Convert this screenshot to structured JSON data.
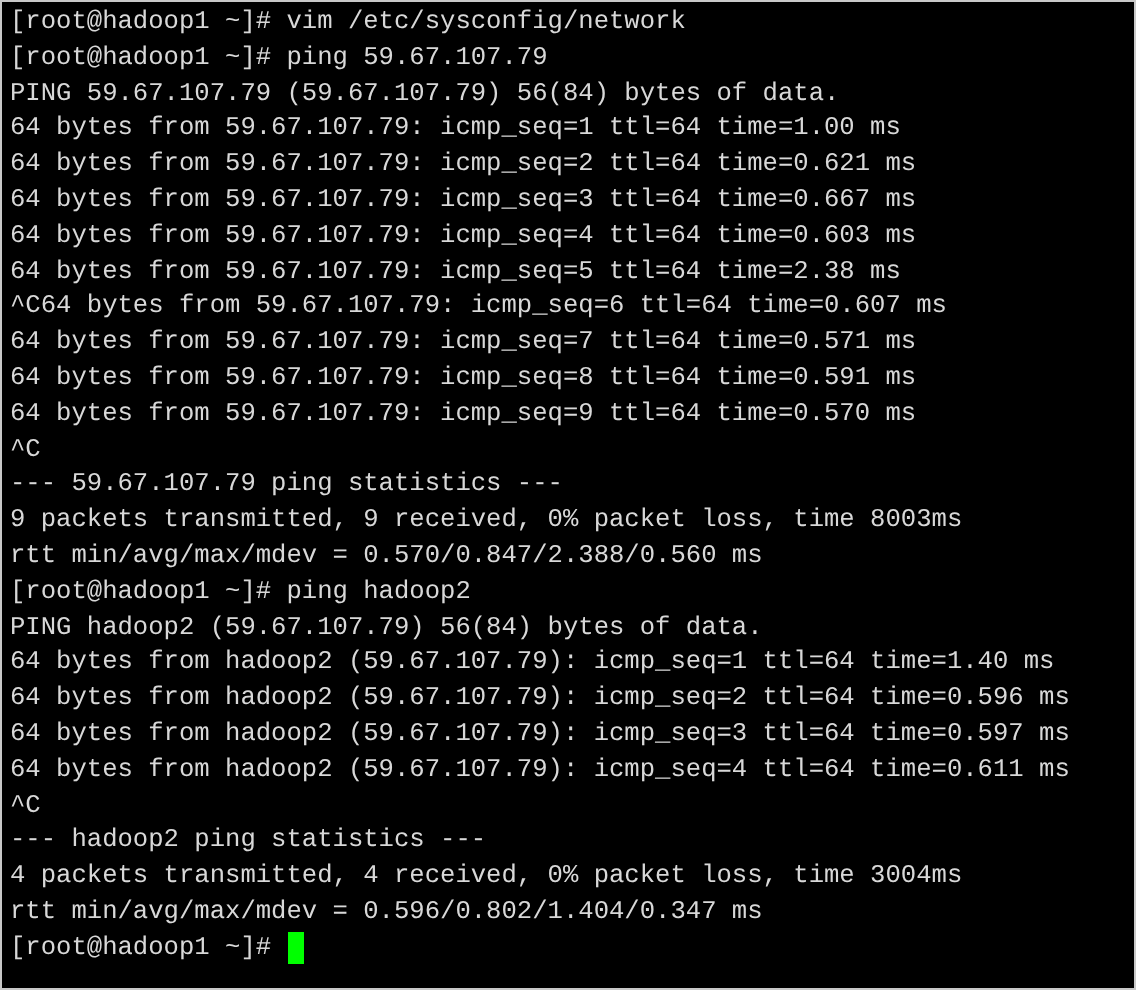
{
  "terminal": {
    "lines": [
      "[root@hadoop1 ~]# vim /etc/sysconfig/network",
      "[root@hadoop1 ~]# ping 59.67.107.79",
      "PING 59.67.107.79 (59.67.107.79) 56(84) bytes of data.",
      "64 bytes from 59.67.107.79: icmp_seq=1 ttl=64 time=1.00 ms",
      "64 bytes from 59.67.107.79: icmp_seq=2 ttl=64 time=0.621 ms",
      "64 bytes from 59.67.107.79: icmp_seq=3 ttl=64 time=0.667 ms",
      "64 bytes from 59.67.107.79: icmp_seq=4 ttl=64 time=0.603 ms",
      "64 bytes from 59.67.107.79: icmp_seq=5 ttl=64 time=2.38 ms",
      "^C64 bytes from 59.67.107.79: icmp_seq=6 ttl=64 time=0.607 ms",
      "64 bytes from 59.67.107.79: icmp_seq=7 ttl=64 time=0.571 ms",
      "64 bytes from 59.67.107.79: icmp_seq=8 ttl=64 time=0.591 ms",
      "64 bytes from 59.67.107.79: icmp_seq=9 ttl=64 time=0.570 ms",
      "^C",
      "--- 59.67.107.79 ping statistics ---",
      "9 packets transmitted, 9 received, 0% packet loss, time 8003ms",
      "rtt min/avg/max/mdev = 0.570/0.847/2.388/0.560 ms",
      "[root@hadoop1 ~]# ping hadoop2",
      "PING hadoop2 (59.67.107.79) 56(84) bytes of data.",
      "64 bytes from hadoop2 (59.67.107.79): icmp_seq=1 ttl=64 time=1.40 ms",
      "64 bytes from hadoop2 (59.67.107.79): icmp_seq=2 ttl=64 time=0.596 ms",
      "64 bytes from hadoop2 (59.67.107.79): icmp_seq=3 ttl=64 time=0.597 ms",
      "64 bytes from hadoop2 (59.67.107.79): icmp_seq=4 ttl=64 time=0.611 ms",
      "^C",
      "--- hadoop2 ping statistics ---",
      "4 packets transmitted, 4 received, 0% packet loss, time 3004ms",
      "rtt min/avg/max/mdev = 0.596/0.802/1.404/0.347 ms"
    ],
    "prompt": "[root@hadoop1 ~]#",
    "cursor": true
  }
}
